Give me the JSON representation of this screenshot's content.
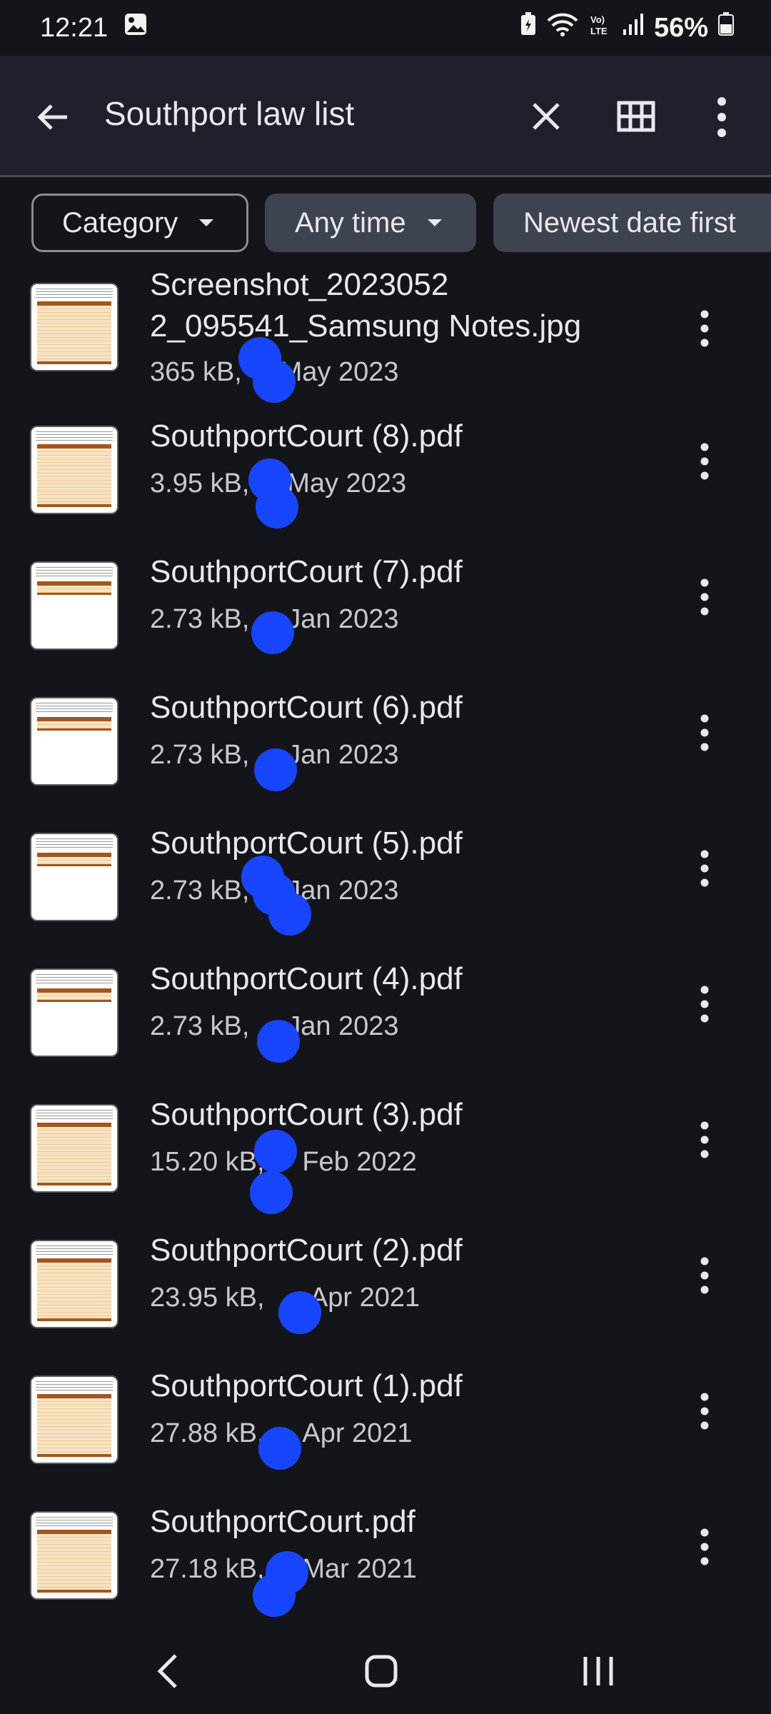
{
  "status_bar": {
    "time": "12:21",
    "battery": "56%"
  },
  "app_bar": {
    "title": "Southport law list"
  },
  "chips": {
    "category": "Category",
    "time": "Any time",
    "sort": "Newest date first"
  },
  "files": [
    {
      "name_line1": "Screenshot_2023052",
      "name_line2": "2_095541_Samsung Notes.jpg",
      "meta": "365 kB,     May 2023",
      "thumb": "table-tall"
    },
    {
      "name_line1": "SouthportCourt (8).pdf",
      "meta": "3.95 kB,     May 2023",
      "thumb": "table-tall"
    },
    {
      "name_line1": "SouthportCourt (7).pdf",
      "meta": "2.73 kB,     Jan 2023",
      "thumb": "table-short"
    },
    {
      "name_line1": "SouthportCourt (6).pdf",
      "meta": "2.73 kB,     Jan 2023",
      "thumb": "table-short"
    },
    {
      "name_line1": "SouthportCourt (5).pdf",
      "meta": "2.73 kB,     Jan 2023",
      "thumb": "table-short"
    },
    {
      "name_line1": "SouthportCourt (4).pdf",
      "meta": "2.73 kB,     Jan 2023",
      "thumb": "table-short"
    },
    {
      "name_line1": "SouthportCourt (3).pdf",
      "meta": "15.20 kB,     Feb 2022",
      "thumb": "table-tall"
    },
    {
      "name_line1": "SouthportCourt (2).pdf",
      "meta": "23.95 kB,      Apr 2021",
      "thumb": "table-tall"
    },
    {
      "name_line1": "SouthportCourt (1).pdf",
      "meta": "27.88 kB,     Apr 2021",
      "thumb": "table-tall"
    },
    {
      "name_line1": "SouthportCourt.pdf",
      "meta": "27.18 kB,     Mar 2021",
      "thumb": "table-tall"
    }
  ],
  "icons": {
    "back": "arrow-back-icon",
    "clear": "close-icon",
    "grid": "grid-view-icon",
    "more": "more-vert-icon",
    "nav_back": "nav-back-icon",
    "nav_home": "nav-home-icon",
    "nav_recents": "nav-recents-icon"
  },
  "colors": {
    "background": "#14151a",
    "app_bar": "#1e2129",
    "chip_filled": "#3e4350",
    "touch_dot": "#1846ff"
  }
}
